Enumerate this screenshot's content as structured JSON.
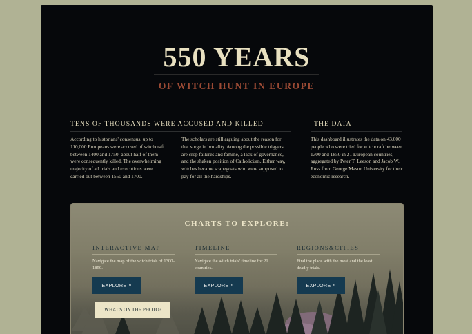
{
  "header": {
    "title": "550 YEARS",
    "subtitle": "OF WITCH HUNT IN EUROPE"
  },
  "intro": {
    "heading": "TENS OF THOUSANDS WERE ACCUSED AND KILLED",
    "col1": "According to historians' consensus, up to 110,000 Europeans were accused of witchcraft between 1400 and 1750; about half of them were consequently killed. The overwhelming majority of all trials and executions were carried out between 1550 and 1700.",
    "col2": "The scholars are still arguing about the reason for that surge in brutality. Among the possible triggers are crop failures and famine, a lack of governance, and the shaken position of Catholicism. Either way, witches became scapegoats who were supposed to pay for all the hardships."
  },
  "data_section": {
    "heading": "THE DATA",
    "text": "This dashboard illustrates the data on 43,000 people who were tried for witchcraft between 1300 and 1850 in 21 European countries, aggregated by Peter T. Leeson and Jacob W. Russ from George Mason University for their economic research."
  },
  "explore": {
    "title": "CHARTS TO EXPLORE:",
    "cards": [
      {
        "heading": "INTERACTIVE MAP",
        "text": "Navigate the map of the witch trials of 1300–1850.",
        "button": "EXPLORE"
      },
      {
        "heading": "TIMELINE",
        "text": "Navigate the witch trials' timeline for 21 countries.",
        "button": "EXPLORE"
      },
      {
        "heading": "REGIONS&CITIES",
        "text": "Find the place with the most and the least deadly trials.",
        "button": "EXPLORE"
      }
    ],
    "photo_button": "WHAT'S ON THE PHOTO?"
  },
  "colors": {
    "page_bg": "#b0b294",
    "panel_bg": "#06080b",
    "title": "#e8e0c0",
    "subtitle": "#9b4a34",
    "button": "#153a50"
  },
  "icons": {
    "explore_chevron": "double-chevron-down-icon"
  }
}
